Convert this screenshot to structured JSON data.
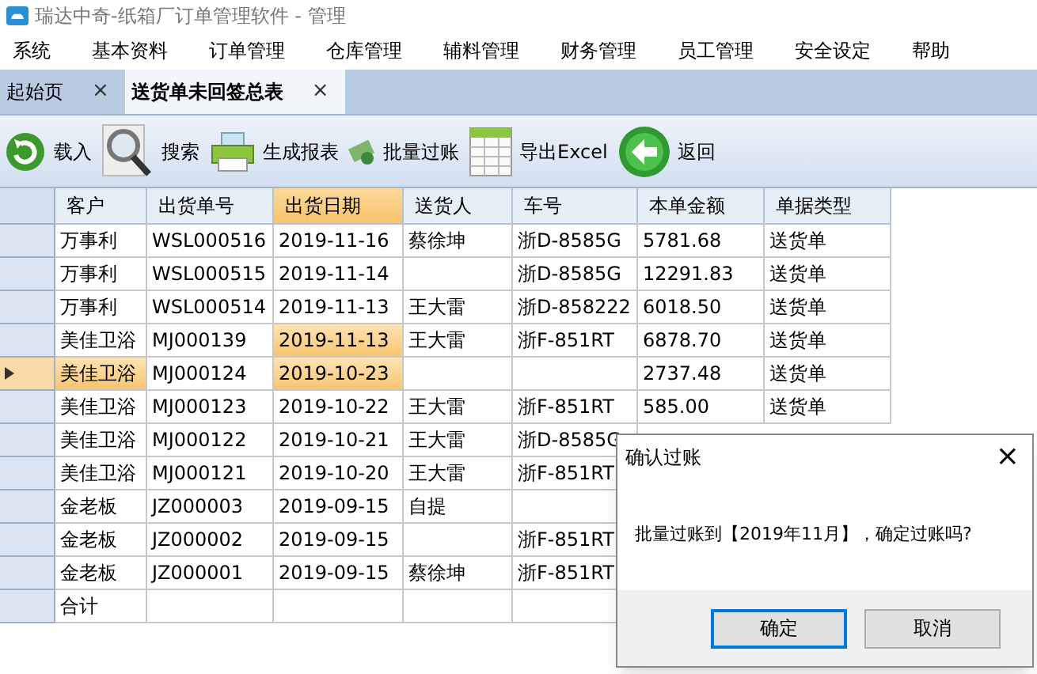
{
  "window": {
    "title": "瑞达中奇-纸箱厂订单管理软件 - 管理"
  },
  "menu": [
    "系统",
    "基本资料",
    "订单管理",
    "仓库管理",
    "辅料管理",
    "财务管理",
    "员工管理",
    "安全设定",
    "帮助"
  ],
  "tabs": [
    {
      "label": "起始页",
      "close": "×",
      "selected": false
    },
    {
      "label": "送货单未回签总表",
      "close": "×",
      "selected": true
    }
  ],
  "toolbar": [
    {
      "kind": "reload",
      "label": "载入"
    },
    {
      "kind": "search",
      "label": "搜索"
    },
    {
      "kind": "print",
      "label": "生成报表"
    },
    {
      "kind": "money",
      "label": "批量过账"
    },
    {
      "kind": "excel",
      "label": "导出Excel"
    },
    {
      "kind": "back",
      "label": "返回"
    }
  ],
  "table": {
    "columns": [
      {
        "label": "客户",
        "selected": false
      },
      {
        "label": "出货单号",
        "selected": false
      },
      {
        "label": "出货日期",
        "selected": true
      },
      {
        "label": "送货人",
        "selected": false
      },
      {
        "label": "车号",
        "selected": false
      },
      {
        "label": "本单金额",
        "selected": false
      },
      {
        "label": "单据类型",
        "selected": false
      }
    ],
    "rows": [
      {
        "selected": false,
        "cells": [
          {
            "text": "万事利",
            "selected": false
          },
          {
            "text": "WSL000516",
            "selected": false
          },
          {
            "text": "2019-11-16",
            "selected": false
          },
          {
            "text": "蔡徐坤",
            "selected": false
          },
          {
            "text": "浙D-8585G",
            "selected": false
          },
          {
            "text": "5781.68",
            "selected": false
          },
          {
            "text": "送货单",
            "selected": false
          }
        ]
      },
      {
        "selected": false,
        "cells": [
          {
            "text": "万事利",
            "selected": false
          },
          {
            "text": "WSL000515",
            "selected": false
          },
          {
            "text": "2019-11-14",
            "selected": false
          },
          {
            "selected": false
          },
          {
            "text": "浙D-8585G",
            "selected": false
          },
          {
            "text": "12291.83",
            "selected": false
          },
          {
            "text": "送货单",
            "selected": false
          }
        ]
      },
      {
        "selected": false,
        "cells": [
          {
            "text": "万事利",
            "selected": false
          },
          {
            "text": "WSL000514",
            "selected": false
          },
          {
            "text": "2019-11-13",
            "selected": false
          },
          {
            "text": "王大雷",
            "selected": false
          },
          {
            "text": "浙D-858222",
            "selected": false
          },
          {
            "text": "6018.50",
            "selected": false
          },
          {
            "text": "送货单",
            "selected": false
          }
        ]
      },
      {
        "selected": false,
        "cells": [
          {
            "text": "美佳卫浴",
            "selected": false
          },
          {
            "text": "MJ000139",
            "selected": false
          },
          {
            "text": "2019-11-13",
            "selected": true
          },
          {
            "text": "王大雷",
            "selected": false
          },
          {
            "text": "浙F-851RT",
            "selected": false
          },
          {
            "text": "6878.70",
            "selected": false
          },
          {
            "text": "送货单",
            "selected": false
          }
        ]
      },
      {
        "selected": true,
        "cells": [
          {
            "text": "美佳卫浴",
            "selected": true
          },
          {
            "text": "MJ000124",
            "selected": false
          },
          {
            "text": "2019-10-23",
            "selected": true
          },
          {
            "selected": false
          },
          {
            "selected": false
          },
          {
            "text": "2737.48",
            "selected": false
          },
          {
            "text": "送货单",
            "selected": false
          }
        ]
      },
      {
        "selected": false,
        "cells": [
          {
            "text": "美佳卫浴",
            "selected": false
          },
          {
            "text": "MJ000123",
            "selected": false
          },
          {
            "text": "2019-10-22",
            "selected": false
          },
          {
            "text": "王大雷",
            "selected": false
          },
          {
            "text": "浙F-851RT",
            "selected": false
          },
          {
            "text": "585.00",
            "selected": false
          },
          {
            "text": "送货单",
            "selected": false
          }
        ]
      },
      {
        "selected": false,
        "cells": [
          {
            "text": "美佳卫浴",
            "selected": false
          },
          {
            "text": "MJ000122",
            "selected": false
          },
          {
            "text": "2019-10-21",
            "selected": false
          },
          {
            "text": "王大雷",
            "selected": false
          },
          {
            "text": "浙D-8585G",
            "selected": false
          }
        ]
      },
      {
        "selected": false,
        "cells": [
          {
            "text": "美佳卫浴",
            "selected": false
          },
          {
            "text": "MJ000121",
            "selected": false
          },
          {
            "text": "2019-10-20",
            "selected": false
          },
          {
            "text": "王大雷",
            "selected": false
          },
          {
            "text": "浙F-851RT",
            "selected": false
          }
        ]
      },
      {
        "selected": false,
        "cells": [
          {
            "text": "金老板",
            "selected": false
          },
          {
            "text": "JZ000003",
            "selected": false
          },
          {
            "text": "2019-09-15",
            "selected": false
          },
          {
            "text": "自提",
            "selected": false
          },
          {
            "selected": false
          }
        ]
      },
      {
        "selected": false,
        "cells": [
          {
            "text": "金老板",
            "selected": false
          },
          {
            "text": "JZ000002",
            "selected": false
          },
          {
            "text": "2019-09-15",
            "selected": false
          },
          {
            "selected": false
          },
          {
            "text": "浙F-851RT",
            "selected": false
          }
        ]
      },
      {
        "selected": false,
        "cells": [
          {
            "text": "金老板",
            "selected": false
          },
          {
            "text": "JZ000001",
            "selected": false
          },
          {
            "text": "2019-09-15",
            "selected": false
          },
          {
            "text": "蔡徐坤",
            "selected": false
          },
          {
            "text": "浙F-851RT",
            "selected": false
          }
        ]
      },
      {
        "selected": false,
        "cells": [
          {
            "text": "合计",
            "selected": false
          },
          {
            "selected": false
          },
          {
            "selected": false
          },
          {
            "selected": false
          },
          {
            "selected": false
          }
        ]
      }
    ]
  },
  "dialog": {
    "title": "确认过账",
    "close": "×",
    "message": "批量过账到【2019年11月】，确定过账吗?",
    "buttons": [
      {
        "label": "确定",
        "selected": true
      },
      {
        "label": "取消",
        "selected": false
      }
    ]
  }
}
